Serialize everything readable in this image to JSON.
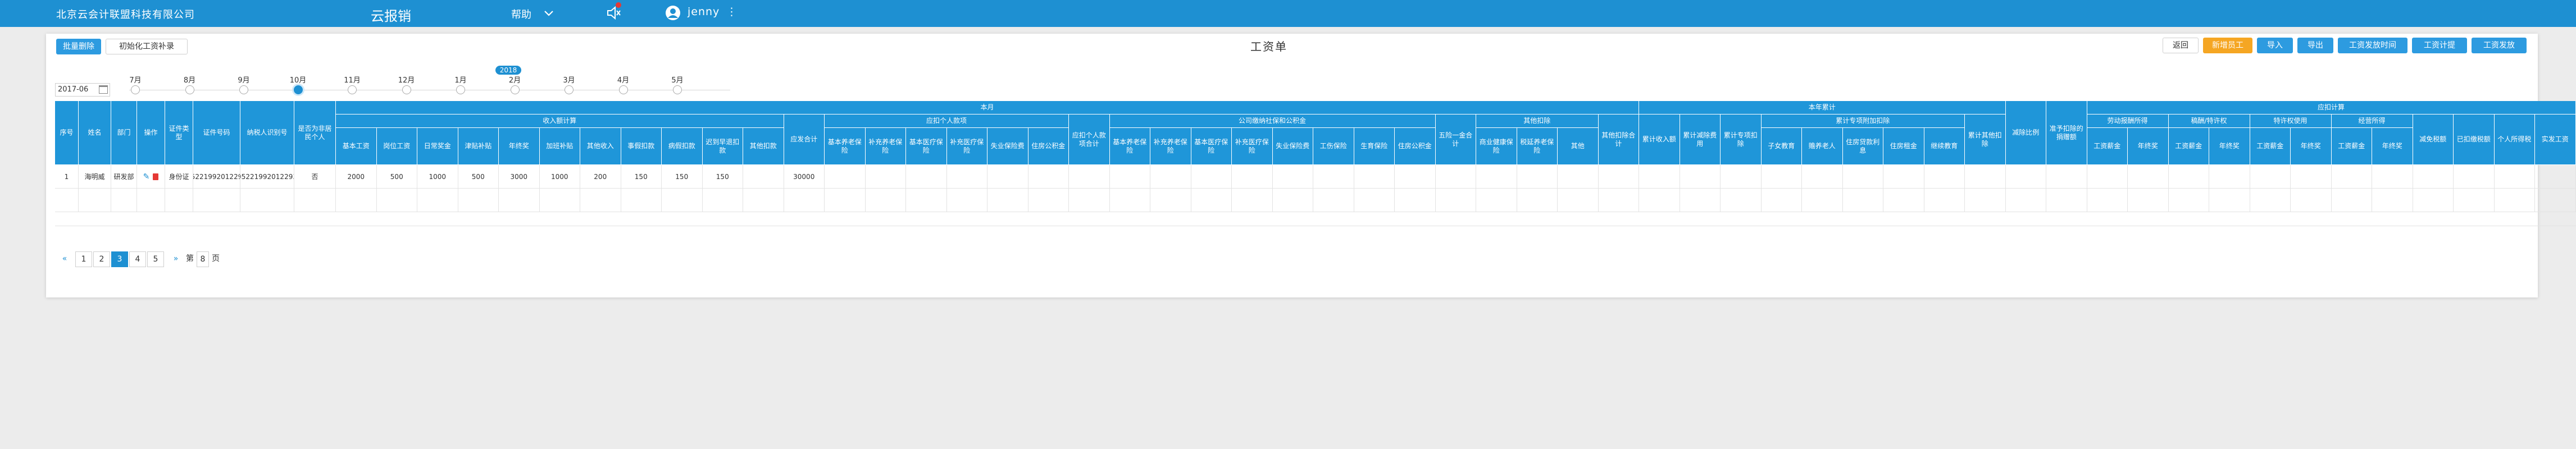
{
  "topbar": {
    "company": "北京云会计联盟科技有限公司",
    "app": "云报销",
    "help": "帮助",
    "user": "jenny"
  },
  "toolbar": {
    "batch_delete": "批量删除",
    "init_records": "初始化工资补录"
  },
  "page_title": "工资单",
  "actions": [
    "返回",
    "新增员工",
    "导入",
    "导出",
    "工资发放时间",
    "工资计提",
    "工资发放"
  ],
  "period": {
    "year_value": "2017-06",
    "year_badge": "2018",
    "months": [
      "7月",
      "8月",
      "9月",
      "10月",
      "11月",
      "12月",
      "1月",
      "2月",
      "3月",
      "4月",
      "5月"
    ],
    "selected": "10月"
  },
  "table": {
    "group_headers": {
      "current_month": "本月",
      "ytd": "本年累计",
      "withhold_calc": "应扣计算",
      "income_items": "收入额计算",
      "personal_deductions": "应扣个人款项",
      "company_insurance": "公司缴纳社保和公积金",
      "other_deductions": "其他扣除",
      "special_ytd": "累计专项附加扣除",
      "labor_comp": "劳动报酬所得",
      "author_comp": "稿酬/特许权",
      "royalty": "特许权使用",
      "op_income": "经营所得"
    },
    "col_headers": {
      "seq": "序号",
      "name": "姓名",
      "dept": "部门",
      "op": "操作",
      "id_type": "证件类型",
      "id_no": "证件号码",
      "taxpayer_no": "纳税人识别号",
      "is_employee": "是否为非居民个人",
      "base_salary": "基本工资",
      "post_salary": "岗位工资",
      "perf_bonus": "日常奖金",
      "allowance": "津贴补贴",
      "annual_bonus": "年终奖",
      "overtime": "加班补贴",
      "other_income": "其他收入",
      "absence_ded": "事假扣款",
      "sick_ded": "病假扣款",
      "late_ded": "迟到早退扣款",
      "other_ded": "其他扣款",
      "income_total": "应发合计",
      "pension": "基本养老保险",
      "supp_pension": "补充养老保险",
      "medical": "基本医疗保险",
      "supp_medical": "补充医疗保险",
      "unemployment": "失业保险费",
      "housing": "住房公积金",
      "personal_total": "应扣个人款项合计",
      "co_pension": "基本养老保险",
      "co_supp_pension": "补充养老保险",
      "co_medical": "基本医疗保险",
      "co_supp_medical": "补充医疗保险",
      "co_unemployment": "失业保险费",
      "co_injury": "工伤保险",
      "co_maternity": "生育保险",
      "co_housing": "住房公积金",
      "three_total": "五险一金合计",
      "health_ins": "商业健康保险",
      "tax_deferred": "税延养老保险",
      "other": "其他",
      "other_total": "其他扣除合计",
      "ytd_income": "累计收入额",
      "ytd_free": "累计减除费用",
      "ytd_special": "累计专项扣除",
      "children_edu": "子女教育",
      "elder_care": "赡养老人",
      "mortgage": "住房贷款利息",
      "rent": "住房租金",
      "cont_edu": "继续教育",
      "ytd_other": "累计其他扣除",
      "tax_rate": "减除比例",
      "donation": "准予扣除的捐赠额",
      "labor_salary": "工资薪金",
      "labor_bonus": "年终奖",
      "author_salary": "工资薪金",
      "author_bonus": "年终奖",
      "roy_salary": "工资薪金",
      "roy_bonus": "年终奖",
      "op_salary": "工资薪金",
      "op_bonus": "年终奖",
      "reduce": "减免税额",
      "prepaid": "已扣缴税额",
      "tax_due": "个人所得税",
      "net_pay": "实发工资"
    },
    "rows": [
      {
        "seq": "1",
        "name": "海明威",
        "dept": "研发部",
        "id_type": "身份证",
        "id_no": "42052219920122930E",
        "taxpayer_no": "42052219920122930E",
        "is_employee": "否",
        "base_salary": "2000",
        "post_salary": "500",
        "perf_bonus": "1000",
        "allowance": "500",
        "annual_bonus": "3000",
        "overtime": "1000",
        "other_income": "200",
        "absence_ded": "150",
        "sick_ded": "150",
        "late_ded": "150",
        "income_total": "30000"
      }
    ]
  },
  "pager": {
    "prev": "«",
    "pages": [
      "1",
      "2",
      "3",
      "4",
      "5"
    ],
    "active": "3",
    "next": "»",
    "jump_label": "第",
    "jump_value": "8",
    "jump_unit": "页"
  }
}
